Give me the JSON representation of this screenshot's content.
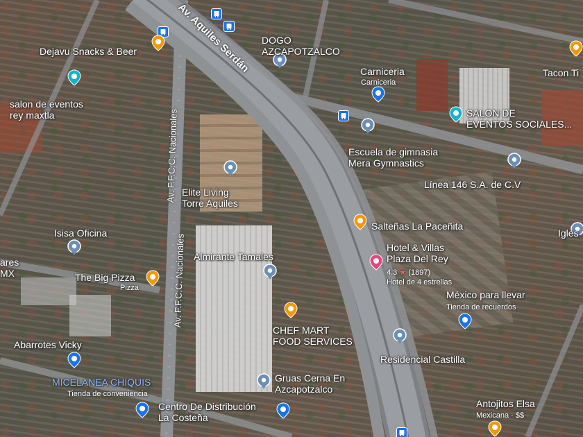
{
  "colors": {
    "food": "#f29900",
    "place": "#6c8fb7",
    "shop": "#1a73e8",
    "event": "#12b5cb",
    "hotel": "#e8457f",
    "road": "#8f9295"
  },
  "roads": {
    "aquiles": "Av. Aquiles Serdán",
    "nacionales_top": "Av. F.F.C.C. Nacionales",
    "nacionales_bottom": "Av. F.F.C.C. Nacionales"
  },
  "pois": {
    "dejavu": {
      "name": "Dejavu Snacks & Beer",
      "icon": "cocktail-icon"
    },
    "salon_maxtla": {
      "name": "salon de eventos\nrey maxtla",
      "icon": "event-venue-icon"
    },
    "dogo": {
      "name": "DOGO\nAZCAPOTZALCO",
      "icon": "place-pin-icon"
    },
    "carniceria": {
      "name": "Carniceria",
      "sub": "Carniceria",
      "icon": "shopping-bag-icon"
    },
    "salon_sociales": {
      "name": "SALON DE\nEVENTOS SOCIALES...",
      "icon": "event-venue-icon"
    },
    "tacon": {
      "name": "Tacon Ti",
      "icon": "restaurant-icon"
    },
    "escuela": {
      "name": "Escuela de gimnasia\nMera Gymnastics",
      "icon": "place-pin-icon"
    },
    "linea146": {
      "name": "Línea 146 S.A. de C.V",
      "icon": "place-pin-icon"
    },
    "elite": {
      "name": "Elite Living\nTorre Aquiles",
      "icon": "place-pin-icon"
    },
    "saltenas": {
      "name": "Salteñas La Paceñita",
      "icon": "restaurant-icon"
    },
    "iglesia": {
      "name": "Igles",
      "icon": "church-icon"
    },
    "isisa": {
      "name": "Isisa Oficina",
      "icon": "place-pin-icon"
    },
    "hotel": {
      "name": "Hotel & Villas\nPlaza Del Rey",
      "rating": "4.3",
      "reviews": "(1897)",
      "sub": "Hotel de 4 estrellas",
      "icon": "hotel-bed-icon"
    },
    "almirante": {
      "name": "Almirante Tamales",
      "icon": "place-pin-icon"
    },
    "ares": {
      "name": "ares\nMX"
    },
    "bigpizza": {
      "name": "The Big Pizza",
      "sub": "Pizza",
      "icon": "restaurant-icon"
    },
    "mexico": {
      "name": "México para llevar",
      "sub": "Tienda de recuerdos",
      "icon": "shopping-bag-icon"
    },
    "chefmart": {
      "name": "CHEF MART\nFOOD SERVICES",
      "icon": "restaurant-icon"
    },
    "residencial": {
      "name": "Residencial Castilla",
      "icon": "place-pin-icon"
    },
    "abarrotes": {
      "name": "Abarrotes Vicky",
      "icon": "shopping-cart-icon"
    },
    "miscelanea": {
      "name": "MICELANEA CHIQUIS",
      "sub": "Tienda de conveniencia",
      "icon": "store-icon"
    },
    "gruas": {
      "name": "Gruas Cerna En\nAzcapotzalco",
      "icon": "place-pin-icon"
    },
    "centro": {
      "name": "Centro De Distribución\nLa Costeña",
      "icon": "shopping-bag-icon"
    },
    "antojitos": {
      "name": "Antojitos Elsa",
      "sub": "Mexicana · $$",
      "icon": "restaurant-icon"
    }
  }
}
